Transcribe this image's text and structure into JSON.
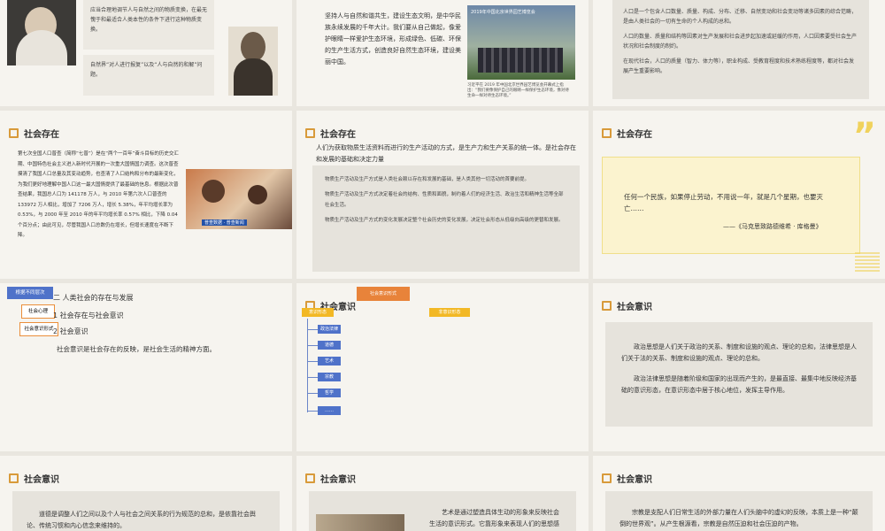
{
  "slide1": {
    "text1": "应当合理地调节人与自然之间的物质变换，在最无愧于和最适合人类本性的条件下进行这种物质变换。",
    "text2": "自然界“对人进行报复”以及“人与自然的和解”问题。"
  },
  "slide2": {
    "text": "坚持人与自然和谐共生，建设生态文明，是中华民族永续发展的千年大计。我们要从自己做起，像爱护眼睛一样爱护生态环境，形成绿色、低碳、环保的生产生活方式，创造良好自然生态环境，建设美丽中国。",
    "photo_banner": "2019年中国北京世界园艺博览会",
    "caption": "习近平在 2019 年中国北京世界园艺博览会开幕式上指出：“我们要像保护自己的眼睛一样保护生态环境，像对待生命一样对待生态环境。”"
  },
  "slide3": {
    "lines": [
      "人口是一个包含人口数量、质量、构成、分布、迁移、自然变动和社会变动等诸多因素的综合范畴，是由人类社会的一切有生命的个人构成的总和。",
      "人口的数量、质量和结构等因素对生产发展和社会进步起加速或延缓的作用，人口因素要受社会生产状况和社会制度的制约。",
      "在现代社会，人口的质量（智力、体力等），职业构成、受教育程度和技术熟练程度等，都对社会发展产生重要影响。"
    ]
  },
  "slide4": {
    "title": "社会存在",
    "para": "第七次全国人口普查（简称“七普”）是在“两个一百年”奋斗目标的历史交汇期、中国特色社会主义进入新时代开展的一次重大国情国力调查。这次普查摸清了我国人口总量及其变动趋势，也查清了人口结构和分布的最新变化，为我们更好地理解中国人口这一最大国情提供了最基础的信息。根据此次普查结果，我国总人口为 141178 万人，与 2010 年第六次人口普查的 133972 万人相比，增加了 7206 万人，增长 5.38%，年平均增长率为 0.53%，与 2000 年至 2010 年的年平均增长率 0.57% 相比，下降 0.04 个百分点；由此可见，尽管我国人口总数仍在增长，但增长速度在不断下降。",
    "photo_caption": "普查数据 · 普查新闻"
  },
  "slide5": {
    "title": "社会存在",
    "intro": "人们为获取物质生活资料而进行的生产活动的方式，是生产力和生产关系的统一体。是社会存在和发展的基础和决定力量",
    "lines": [
      "物质生产活动及生产方式是人类社会赖以存在和发展的基础，是人类其他一切活动的首要前提。",
      "物质生产活动及生产方式决定着社会的结构、性质和面貌，制约着人们的经济生活、政治生活和精神生活等全部社会生活。",
      "物质生产活动及生产方式的变化发展决定整个社会历史的变化发展，决定社会形态从低级向高级的更替和发展。"
    ]
  },
  "slide6": {
    "title": "社会存在",
    "quote": "任何一个民族，如果停止劳动，不用说一年，就是几个星期，也要灭亡……",
    "source": "——《马克思致路德维希 · 库格曼》",
    "quote_mark": "”"
  },
  "slide7": {
    "tags": [
      "根据不同层次",
      "社会心理",
      "社会意识形式"
    ],
    "lines": [
      "二  人类社会的存在与发展",
      "1  社会存在与社会意识",
      "2  社会意识"
    ],
    "para": "社会意识是社会存在的反映，是社会生活的精神方面。"
  },
  "slide8": {
    "title": "社会意识",
    "top_tag": "社会意识形式",
    "left_tag": "意识形态",
    "right_tag": "非意识形态",
    "items": [
      "政治法律",
      "道德",
      "艺术",
      "宗教",
      "哲学",
      "……"
    ]
  },
  "slide9": {
    "title": "社会意识",
    "p1": "政治思想是人们关于政治的关系、制度和设施的观点、理论的总和，法律思想是人们关于法的关系、制度和设施的观点、理论的总和。",
    "p2": "政治法律思想是随着阶级和国家的出现而产生的，是最直接、最集中地反映经济基础的意识形态，在意识形态中居于核心地位，发挥主导作用。"
  },
  "slide10": {
    "title": "社会意识",
    "text": "道德是调整人们之间以及个人与社会之间关系的行为规范的总和，是依靠社会舆论、传统习惯和内心信念来维持的。"
  },
  "slide11": {
    "title": "社会意识",
    "text": "艺术是通过塑造具体生动的形象来反映社会生活的意识形式。它靠形象来表现人们的思想感情。"
  },
  "slide12": {
    "title": "社会意识",
    "text": "宗教是支配人们日常生活的外部力量在人们头脑中的虚幻的反映，本质上是一种“颠倒的世界观”。从产生根源看，宗教是自然压迫和社会压迫的产物。"
  }
}
